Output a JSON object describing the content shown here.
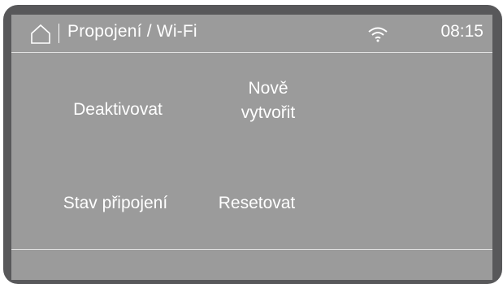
{
  "header": {
    "title": "Propojení / Wi-Fi",
    "time": "08:15",
    "icons": {
      "home": "home-icon",
      "wifi": "wifi-icon"
    }
  },
  "menu": {
    "deactivate": "Deaktivovat",
    "create_new_line1": "Nově",
    "create_new_line2": "vytvořit",
    "connection_status": "Stav připojení",
    "reset": "Resetovat"
  },
  "colors": {
    "bezel": "#58585a",
    "screen": "#9b9b9b",
    "text": "#ffffff"
  }
}
